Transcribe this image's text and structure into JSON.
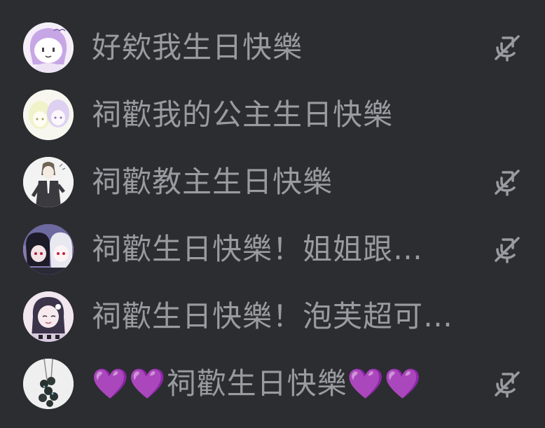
{
  "members": [
    {
      "name": "好欸我生日快樂",
      "muted": true,
      "avatar_icon": "avatar-purple-hair"
    },
    {
      "name": "祠歡我的公主生日快樂",
      "muted": false,
      "avatar_icon": "avatar-pastel-duo"
    },
    {
      "name": "祠歡教主生日快樂",
      "muted": true,
      "avatar_icon": "avatar-suit-figure"
    },
    {
      "name": "祠歡生日快樂！姐姐跟…",
      "muted": true,
      "avatar_icon": "avatar-dark-duo"
    },
    {
      "name": "祠歡生日快樂！泡芙超可…",
      "muted": false,
      "avatar_icon": "avatar-dark-hair-girl"
    },
    {
      "name_prefix": "💜💜",
      "name": "祠歡生日快樂",
      "name_suffix": "💜💜",
      "muted": true,
      "avatar_icon": "avatar-keychain"
    }
  ],
  "colors": {
    "background": "#2c2d31",
    "name_text": "#9a9ba1",
    "icon": "#9a9ba1",
    "heart": "#9b59e6"
  }
}
